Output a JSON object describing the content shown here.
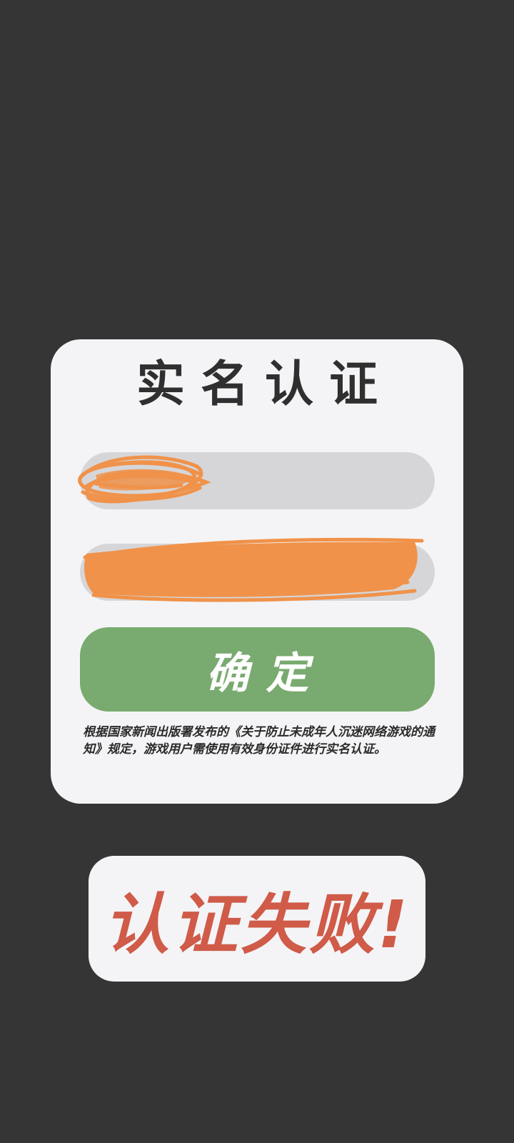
{
  "dialog": {
    "title": "实名认证",
    "name_field": {
      "value": "",
      "placeholder": ""
    },
    "id_field": {
      "value": "",
      "placeholder": ""
    },
    "confirm_label": "确定",
    "notice": "根据国家新闻出版署发布的《关于防止未成年人沉迷网络游戏的通知》规定，游戏用户需使用有效身份证件进行实名认证。"
  },
  "result": {
    "message": "认证失败!"
  },
  "colors": {
    "background": "#353535",
    "dialog": "#f4f4f6",
    "field": "#d6d6d8",
    "confirm": "#79aa6f",
    "fail_text": "#cf5b48",
    "redaction": "#f0924a"
  }
}
